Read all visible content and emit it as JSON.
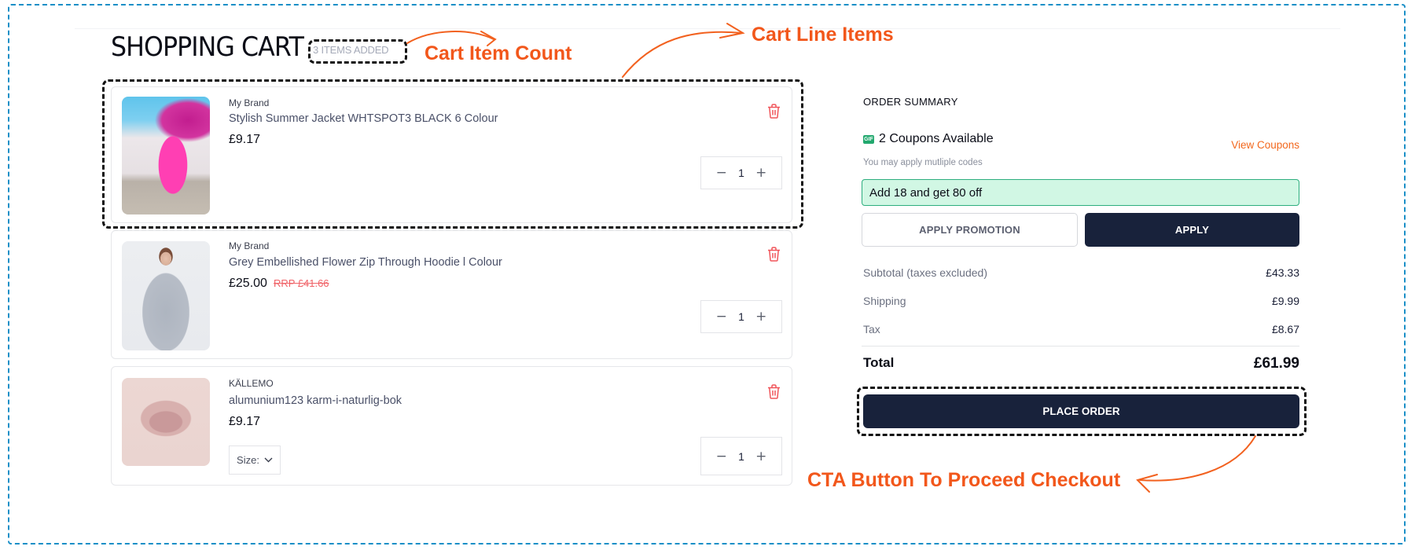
{
  "header": {
    "title": "SHOPPING CART",
    "item_count_badge": "3 ITEMS ADDED"
  },
  "annotations": {
    "cart_item_count": "Cart Item Count",
    "cart_line_items": "Cart Line Items",
    "cta_button": "CTA Button To Proceed Checkout",
    "accent_color": "#f2571b"
  },
  "cart": {
    "items": [
      {
        "brand": "My Brand",
        "title": "Stylish Summer Jacket WHTSPOT3 BLACK 6 Colour",
        "price": "£9.17",
        "rrp": null,
        "quantity": "1",
        "image": "pink-dress-photo"
      },
      {
        "brand": "My Brand",
        "title": "Grey Embellished Flower Zip Through Hoodie l Colour",
        "price": "£25.00",
        "rrp": "RRP £41.66",
        "quantity": "1",
        "image": "grey-hoodie-photo"
      },
      {
        "brand": "KÄLLEMO",
        "title": "alumunium123 karm-i-naturlig-bok",
        "price": "£9.17",
        "rrp": null,
        "quantity": "1",
        "size_label": "Size:",
        "image": "pink-armchair-photo"
      }
    ],
    "decrement_symbol": "−",
    "increment_symbol": "+",
    "delete_icon": "trash-icon"
  },
  "summary": {
    "heading": "ORDER SUMMARY",
    "coupons_available": "2 Coupons Available",
    "coupon_icon": "gif-icon",
    "view_coupons": "View Coupons",
    "coupon_hint": "You may apply mutliple codes",
    "coupon_code_value": "Add 18 and get 80 off",
    "apply_promotion_label": "APPLY PROMOTION",
    "apply_label": "APPLY",
    "lines": [
      {
        "label": "Subtotal (taxes excluded)",
        "value": "£43.33"
      },
      {
        "label": "Shipping",
        "value": "£9.99"
      },
      {
        "label": "Tax",
        "value": "£8.67"
      }
    ],
    "total_label": "Total",
    "total_value": "£61.99",
    "place_order_label": "PLACE ORDER"
  },
  "colors": {
    "primary_button": "#18223b",
    "accent_orange": "#f2681e",
    "delete_red": "#f0555a",
    "coupon_green_bg": "#d1f7e4",
    "coupon_green_border": "#2dae7e",
    "frame_blue": "#1a8fc7"
  }
}
